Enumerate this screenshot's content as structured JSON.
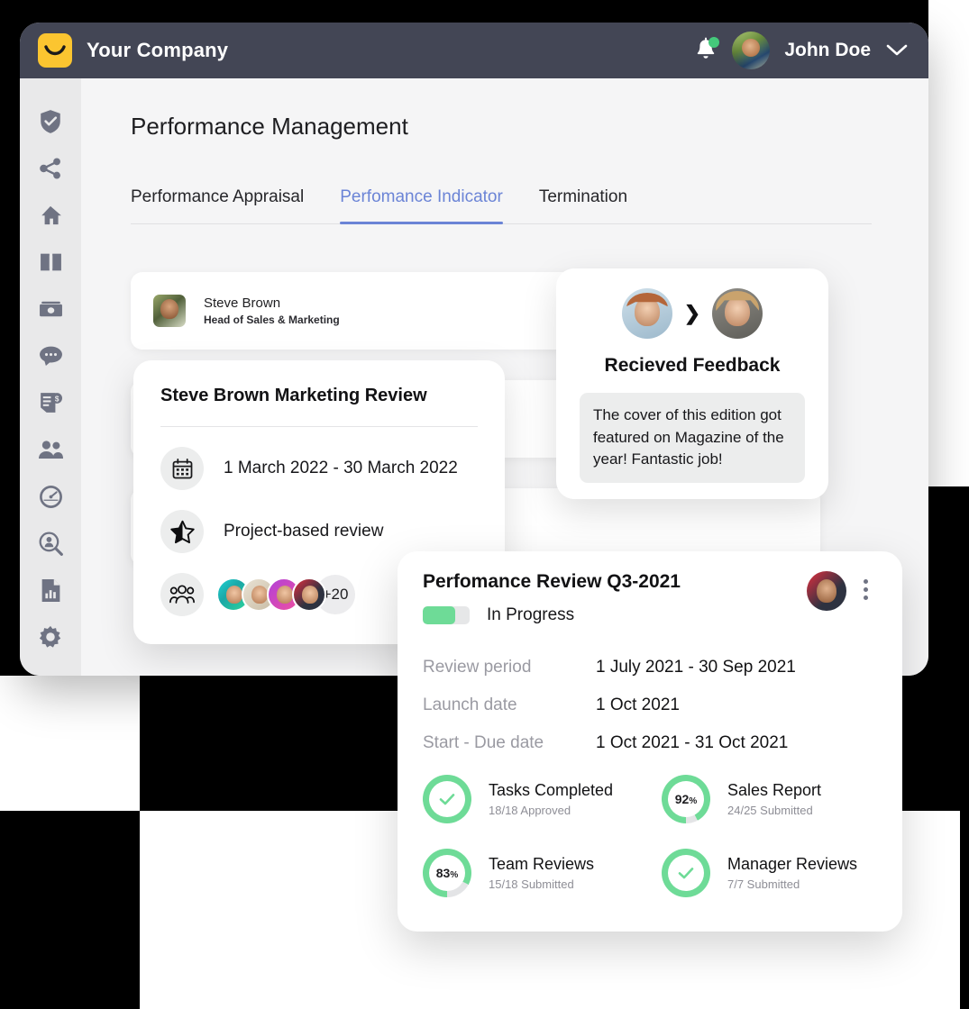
{
  "topbar": {
    "logo_icon": "smile-logo-icon",
    "brand": "Your Company",
    "bell_icon": "notification-bell-icon",
    "user_name": "John Doe",
    "caret_icon": "chevron-down-icon"
  },
  "sidebar": {
    "items": [
      {
        "icon": "shield-check-icon"
      },
      {
        "icon": "share-icon"
      },
      {
        "icon": "home-icon"
      },
      {
        "icon": "book-icon"
      },
      {
        "icon": "money-icon"
      },
      {
        "icon": "chat-icon"
      },
      {
        "icon": "invoice-dollar-icon"
      },
      {
        "icon": "people-icon"
      },
      {
        "icon": "speedometer-icon"
      },
      {
        "icon": "search-person-icon"
      },
      {
        "icon": "chart-document-icon"
      },
      {
        "icon": "gear-icon"
      }
    ]
  },
  "page": {
    "title": "Performance Management"
  },
  "tabs": [
    {
      "label": "Performance Appraisal",
      "active": false
    },
    {
      "label": "Perfomance Indicator",
      "active": true
    },
    {
      "label": "Termination",
      "active": false
    }
  ],
  "list_rows": [
    {
      "name": "Steve Brown",
      "role": "Head of Sales & Marketing"
    },
    {
      "name": "",
      "role": ""
    },
    {
      "name": "",
      "role": ""
    }
  ],
  "marketing_card": {
    "title": "Steve Brown Marketing Review",
    "date_icon": "calendar-icon",
    "date_range": "1 March 2022 - 30 March 2022",
    "type_icon": "half-star-icon",
    "review_type": "Project-based review",
    "people_icon": "group-people-icon",
    "more_people": "+20"
  },
  "feedback_card": {
    "from_avatar": "feedback-sender-avatar",
    "arrow_icon": "chevron-right-icon",
    "to_avatar": "feedback-receiver-avatar",
    "title": "Recieved Feedback",
    "message": "The cover of this edition got featured on Magazine of the year! Fantastic job!"
  },
  "review_card": {
    "title": "Perfomance Review Q3-2021",
    "status": "In Progress",
    "progress_percent": 70,
    "owner_avatar": "review-owner-avatar",
    "kebab_icon": "more-vertical-icon",
    "meta": [
      {
        "key": "Review period",
        "value": "1 July 2021 - 30 Sep 2021"
      },
      {
        "key": "Launch date",
        "value": "1 Oct 2021"
      },
      {
        "key": "Start - Due date",
        "value": "1 Oct 2021 - 31 Oct 2021"
      }
    ],
    "stats": [
      {
        "title": "Tasks Completed",
        "sub": "18/18 Approved",
        "percent": 100,
        "display": "check"
      },
      {
        "title": "Sales Report",
        "sub": "24/25 Submitted",
        "percent": 92,
        "display": "92",
        "suffix": "%"
      },
      {
        "title": "Team Reviews",
        "sub": "15/18 Submitted",
        "percent": 83,
        "display": "83",
        "suffix": "%"
      },
      {
        "title": "Manager Reviews",
        "sub": "7/7 Submitted",
        "percent": 100,
        "display": "check"
      }
    ]
  },
  "colors": {
    "topbar": "#434655",
    "sidebar": "#e9e9ea",
    "accent_blue": "#6b84d6",
    "accent_green": "#6edb97",
    "logo_yellow": "#fbc530",
    "canvas": "#f5f5f6"
  }
}
